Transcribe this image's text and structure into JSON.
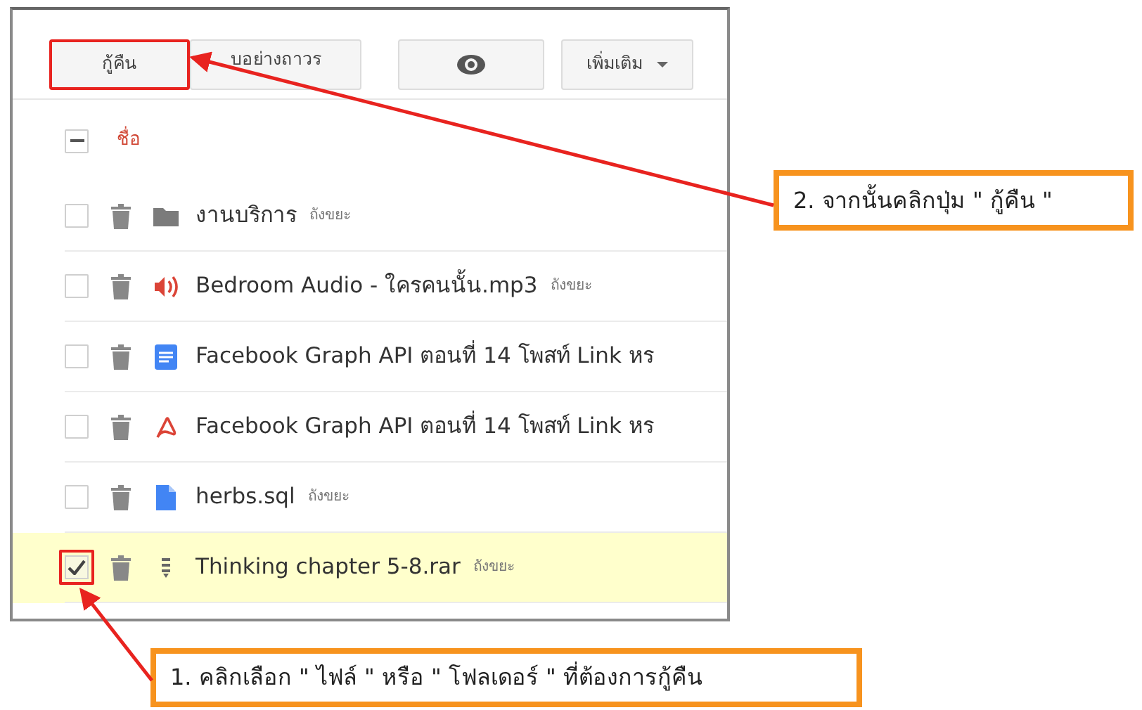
{
  "toolbar": {
    "buttons": [
      {
        "kind": "text",
        "label": "กู้คืน",
        "highlighted": true
      },
      {
        "kind": "text",
        "label": "บอย่างถาวร",
        "highlighted": false
      },
      {
        "kind": "eye",
        "highlighted": false
      },
      {
        "kind": "dropdown",
        "label": "เพิ่มเติม",
        "highlighted": false
      }
    ]
  },
  "header": {
    "select_all_indeterminate": true,
    "column": "ชื่อ"
  },
  "rows": [
    {
      "kind": "folder",
      "name": "งานบริการ",
      "location": "ถังขยะ",
      "checked": false,
      "selected": false,
      "highlighted": false
    },
    {
      "kind": "audio",
      "name": "Bedroom Audio - ใครคนนั้น.mp3",
      "location": "ถังขยะ",
      "checked": false,
      "selected": false,
      "highlighted": false
    },
    {
      "kind": "document",
      "name": "Facebook Graph API ตอนที่ 14 โพสท์ Link หร",
      "checked": false,
      "selected": false,
      "highlighted": false
    },
    {
      "kind": "pdf",
      "name": "Facebook Graph API ตอนที่ 14 โพสท์ Link หร",
      "checked": false,
      "selected": false,
      "highlighted": false
    },
    {
      "kind": "file",
      "name": "herbs.sql",
      "location": "ถังขยะ",
      "checked": false,
      "selected": false,
      "highlighted": false
    },
    {
      "kind": "archive",
      "name": "Thinking chapter 5-8.rar",
      "location": "ถังขยะ",
      "checked": true,
      "selected": true,
      "highlighted": true
    }
  ],
  "callouts": [
    {
      "text": "2. จากนั้นคลิกปุ่ม \" กู้คืน \"",
      "kind": "toolbar"
    },
    {
      "text": "1. คลิกเลือก \" ไฟล์ \" หรือ \" โฟลเดอร์ \" ที่ต้องการกู้คืน",
      "kind": "row"
    }
  ]
}
